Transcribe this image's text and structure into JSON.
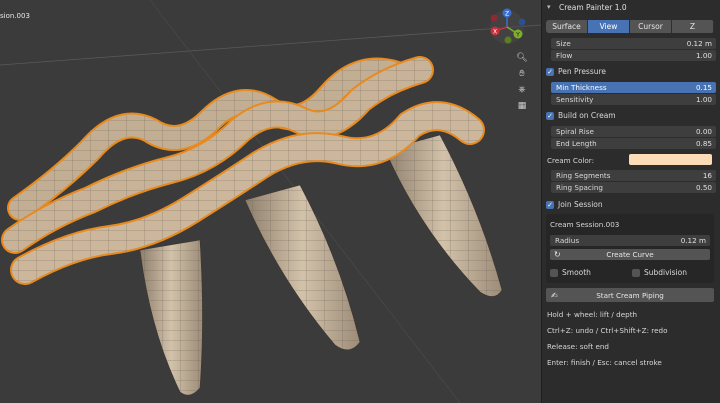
{
  "viewport": {
    "object_name": "sion.003",
    "gizmo_axes": {
      "x": "X",
      "y": "Y",
      "z": "Z"
    },
    "gizmo_colors": {
      "x": "#c6303c",
      "y": "#7cb02a",
      "z": "#3a6fd0"
    }
  },
  "panel": {
    "title": "Cream Painter 1.0",
    "tabs": [
      "Surface",
      "View",
      "Cursor",
      "Z"
    ],
    "active_tab": "View",
    "size": {
      "label": "Size",
      "value": "0.12 m"
    },
    "flow": {
      "label": "Flow",
      "value": "1.00"
    },
    "pen_pressure": {
      "label": "Pen Pressure",
      "checked": true
    },
    "min_thickness": {
      "label": "Min Thickness",
      "value": "0.15"
    },
    "sensitivity": {
      "label": "Sensitivity",
      "value": "1.00"
    },
    "build_on_cream": {
      "label": "Build on Cream",
      "checked": true
    },
    "spiral_rise": {
      "label": "Spiral Rise",
      "value": "0.00"
    },
    "end_length": {
      "label": "End Length",
      "value": "0.85"
    },
    "cream_color": {
      "label": "Cream Color:",
      "hex": "#fbdcb6"
    },
    "ring_segments": {
      "label": "Ring Segments",
      "value": "16"
    },
    "ring_spacing": {
      "label": "Ring Spacing",
      "value": "0.50"
    },
    "join_session": {
      "label": "Join Session",
      "checked": true
    },
    "session": {
      "name": "Cream Session.003",
      "radius": {
        "label": "Radius",
        "value": "0.12 m"
      },
      "create_curve": "Create Curve",
      "smooth": {
        "label": "Smooth",
        "checked": false
      },
      "subdivision": {
        "label": "Subdivision",
        "checked": false
      }
    },
    "start_button": "Start Cream Piping",
    "help": [
      "Hold + wheel: lift / depth",
      "Ctrl+Z: undo / Ctrl+Shift+Z: redo",
      "Release: soft end",
      "Enter: finish / Esc: cancel stroke"
    ]
  }
}
